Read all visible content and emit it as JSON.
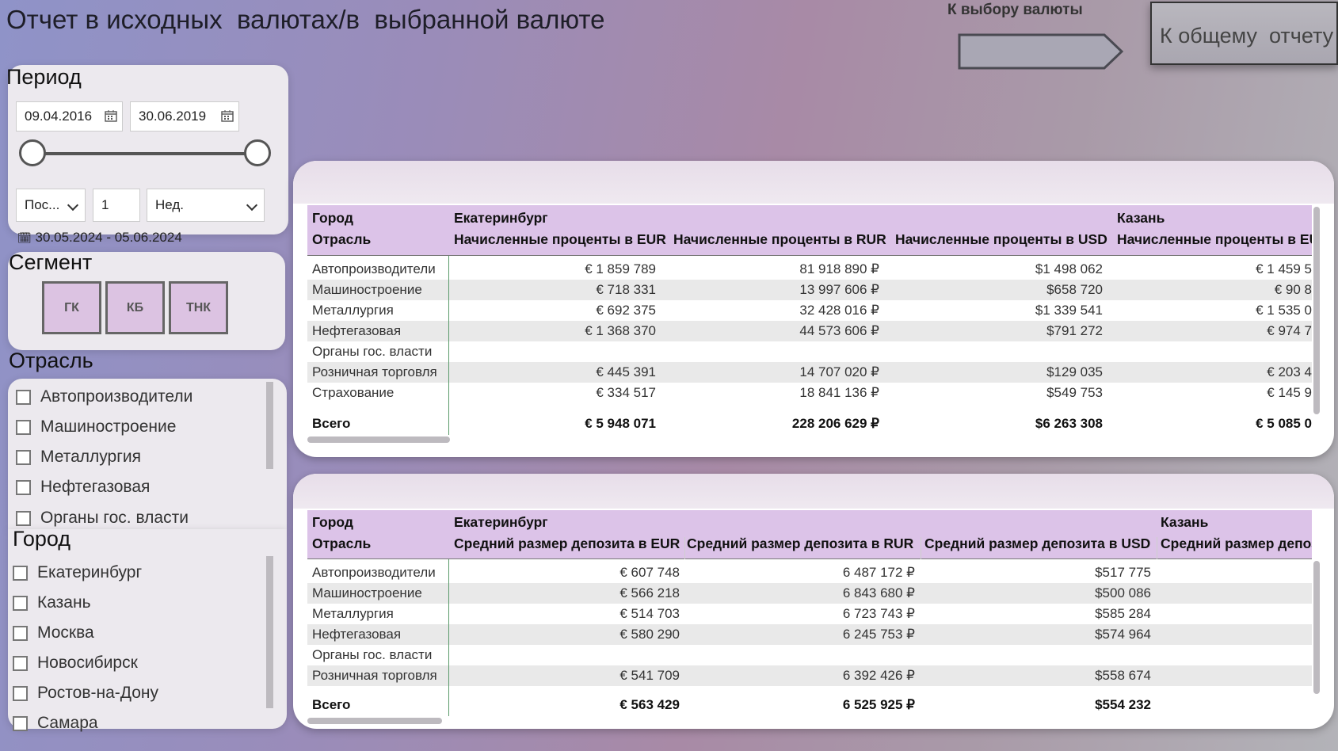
{
  "header": {
    "title": "Отчет в исходных  валютах/в  выбранной валюте",
    "currency_button_label": "К выбору валюты",
    "overall_report_label": "К общему  отчету"
  },
  "period": {
    "title": "Период",
    "start_date": "09.04.2016",
    "end_date": "30.06.2019",
    "relative_mode": "Пос...",
    "relative_count": "1",
    "relative_unit": "Нед.",
    "relative_range": "30.05.2024 - 05.06.2024"
  },
  "segment": {
    "title": "Сегмент",
    "buttons": [
      "ГК",
      "КБ",
      "ТНК"
    ]
  },
  "industry": {
    "title": "Отрасль",
    "items": [
      "Автопроизводители",
      "Машиностроение",
      "Металлургия",
      "Нефтегазовая",
      "Органы гос. власти"
    ]
  },
  "city": {
    "title": "Город",
    "items": [
      "Екатеринбург",
      "Казань",
      "Москва",
      "Новосибирск",
      "Ростов-на-Дону",
      "Самара"
    ]
  },
  "table1": {
    "h_city": "Город",
    "h_industry": "Отрасль",
    "city1": "Екатеринбург",
    "city2": "Казань",
    "col_eur": "Начисленные проценты в EUR",
    "col_rur": "Начисленные проценты в RUR",
    "col_usd": "Начисленные проценты в USD",
    "col_eur2": "Начисленные проценты в EUR",
    "rows": [
      {
        "label": "Автопроизводители",
        "eur": "€ 1 859 789",
        "rur": "81 918 890 ₽",
        "usd": "$1 498 062",
        "eur2": "€ 1 459 5"
      },
      {
        "label": "Машиностроение",
        "eur": "€ 718 331",
        "rur": "13 997 606 ₽",
        "usd": "$658 720",
        "eur2": "€ 90 8"
      },
      {
        "label": "Металлургия",
        "eur": "€ 692 375",
        "rur": "32 428 016 ₽",
        "usd": "$1 339 541",
        "eur2": "€ 1 535 0"
      },
      {
        "label": "Нефтегазовая",
        "eur": "€ 1 368 370",
        "rur": "44 573 606 ₽",
        "usd": "$791 272",
        "eur2": "€ 974 7"
      },
      {
        "label": "Органы гос. власти",
        "eur": "",
        "rur": "",
        "usd": "",
        "eur2": ""
      },
      {
        "label": "Розничная торговля",
        "eur": "€ 445 391",
        "rur": "14 707 020 ₽",
        "usd": "$129 035",
        "eur2": "€ 203 4"
      },
      {
        "label": "Страхование",
        "eur": "€ 334 517",
        "rur": "18 841 136 ₽",
        "usd": "$549 753",
        "eur2": "€ 145 9"
      }
    ],
    "total": {
      "label": "Всего",
      "eur": "€ 5 948 071",
      "rur": "228 206 629 ₽",
      "usd": "$6 263 308",
      "eur2": "€ 5 085 0"
    }
  },
  "table2": {
    "h_city": "Город",
    "h_industry": "Отрасль",
    "city1": "Екатеринбург",
    "city2": "Казань",
    "col_eur": "Средний размер депозита в EUR",
    "col_rur": "Средний размер депозита в RUR",
    "col_usd": "Средний размер депозита в USD",
    "col_eur2": "Средний размер депоз",
    "rows": [
      {
        "label": "Автопроизводители",
        "eur": "€ 607 748",
        "rur": "6 487 172 ₽",
        "usd": "$517 775"
      },
      {
        "label": "Машиностроение",
        "eur": "€ 566 218",
        "rur": "6 843 680 ₽",
        "usd": "$500 086"
      },
      {
        "label": "Металлургия",
        "eur": "€ 514 703",
        "rur": "6 723 743 ₽",
        "usd": "$585 284"
      },
      {
        "label": "Нефтегазовая",
        "eur": "€ 580 290",
        "rur": "6 245 753 ₽",
        "usd": "$574 964"
      },
      {
        "label": "Органы гос. власти",
        "eur": "",
        "rur": "",
        "usd": ""
      },
      {
        "label": "Розничная торговля",
        "eur": "€ 541 709",
        "rur": "6 392 426 ₽",
        "usd": "$558 674"
      }
    ],
    "total": {
      "label": "Всего",
      "eur": "€ 563 429",
      "rur": "6 525 925 ₽",
      "usd": "$554 232"
    }
  },
  "colors": {
    "accent": "#dcc3e8",
    "segment_button": "#dcc3e2"
  }
}
